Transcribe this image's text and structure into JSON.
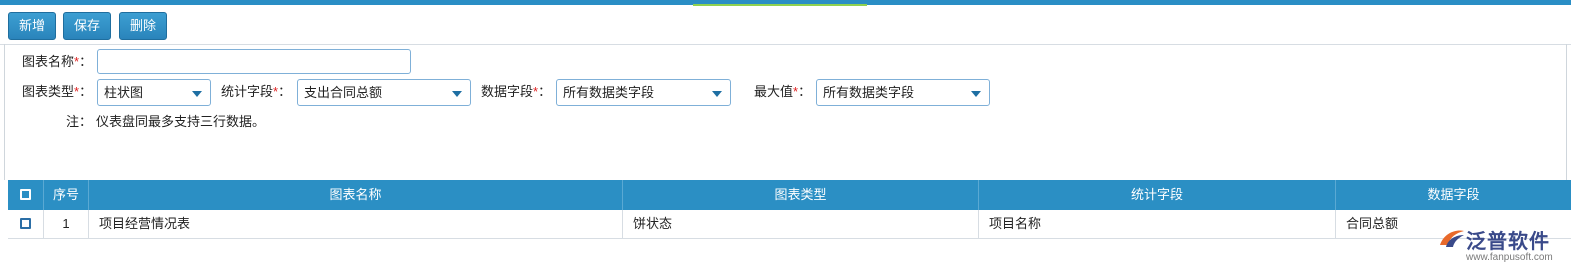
{
  "toolbar": {
    "add_label": "新增",
    "save_label": "保存",
    "delete_label": "删除"
  },
  "form": {
    "chart_name_label": "图表名称",
    "chart_name_value": "",
    "chart_type_label": "图表类型",
    "chart_type_value": "柱状图",
    "stat_field_label": "统计字段",
    "stat_field_value": "支出合同总额",
    "data_field_label": "数据字段",
    "data_field_value": "所有数据类字段",
    "max_label": "最大值",
    "max_value": "所有数据类字段",
    "required_mark": "*",
    "colon": "：",
    "note_label": "注：",
    "note_text": "仪表盘同最多支持三行数据。"
  },
  "table": {
    "headers": [
      "序号",
      "图表名称",
      "图表类型",
      "统计字段",
      "数据字段"
    ],
    "rows": [
      {
        "index": "1",
        "name": "项目经营情况表",
        "type": "饼状态",
        "stat": "项目名称",
        "data": "合同总额"
      }
    ]
  },
  "logo": {
    "brand": "泛普软件",
    "url": "www.fanpusoft.com"
  },
  "colors": {
    "accent": "#2b8fc4",
    "button": "#2a84bb",
    "required": "#e02020",
    "tab_highlight": "#8fd14f"
  }
}
